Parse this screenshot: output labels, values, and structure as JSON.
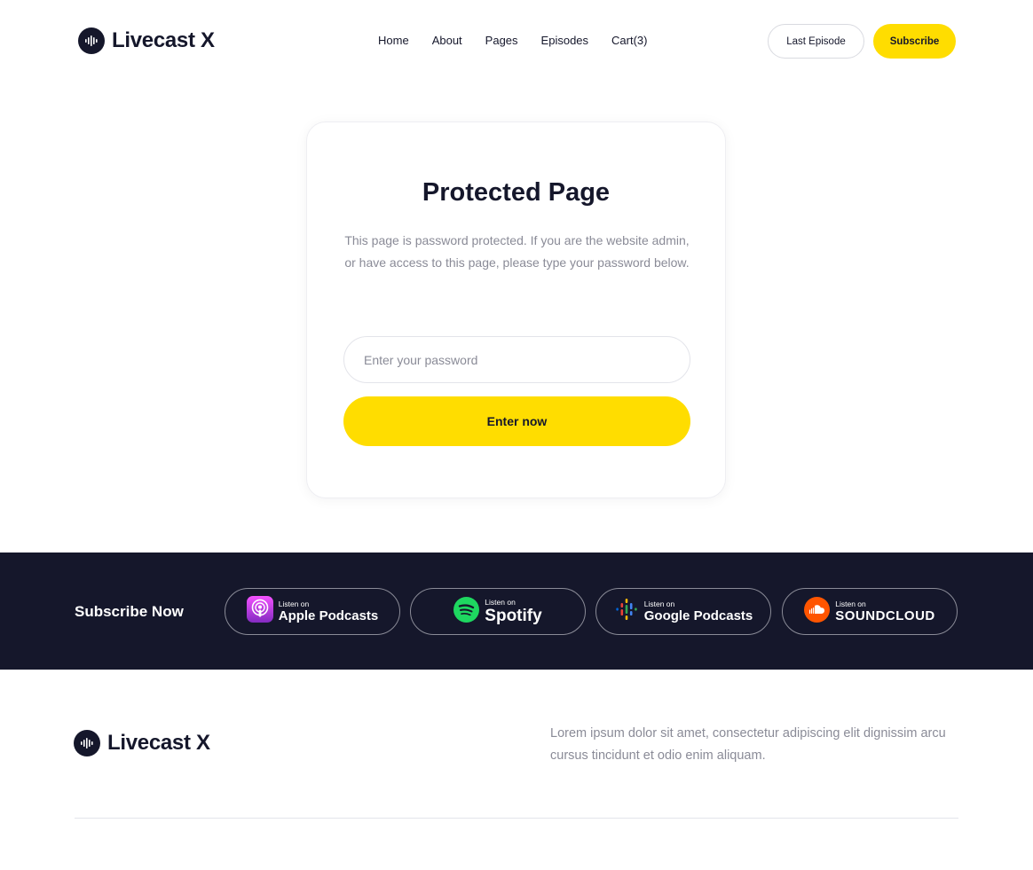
{
  "brand": {
    "name": "Livecast X",
    "icon": "soundwave-logo-icon"
  },
  "nav": {
    "items": [
      {
        "label": "Home"
      },
      {
        "label": "About"
      },
      {
        "label": "Pages"
      },
      {
        "label": "Episodes"
      },
      {
        "label": "Cart(3)"
      }
    ]
  },
  "header_buttons": {
    "last_episode": "Last Episode",
    "subscribe": "Subscribe"
  },
  "card": {
    "title": "Protected Page",
    "description": "This page is password protected. If you are the website admin, or have access to this page, please type your password below.",
    "password_placeholder": "Enter your password",
    "submit_label": "Enter now"
  },
  "subscribe_band": {
    "title": "Subscribe Now",
    "badges": [
      {
        "small": "Listen on",
        "big": "Apple Podcasts",
        "icon": "apple-podcasts-icon"
      },
      {
        "small": "Listen on",
        "big": "Spotify",
        "icon": "spotify-icon"
      },
      {
        "small": "Listen on",
        "big": "Google Podcasts",
        "icon": "google-podcasts-icon"
      },
      {
        "small": "Listen on",
        "big": "SOUNDCLOUD",
        "icon": "soundcloud-icon"
      }
    ]
  },
  "footer": {
    "text": "Lorem ipsum dolor sit amet, consectetur adipiscing elit dignissim arcu cursus tincidunt et odio enim aliquam."
  },
  "colors": {
    "accent": "#ffdd00",
    "dark": "#15172b",
    "muted_text": "#8a8b97",
    "border": "#e3e4ea"
  }
}
